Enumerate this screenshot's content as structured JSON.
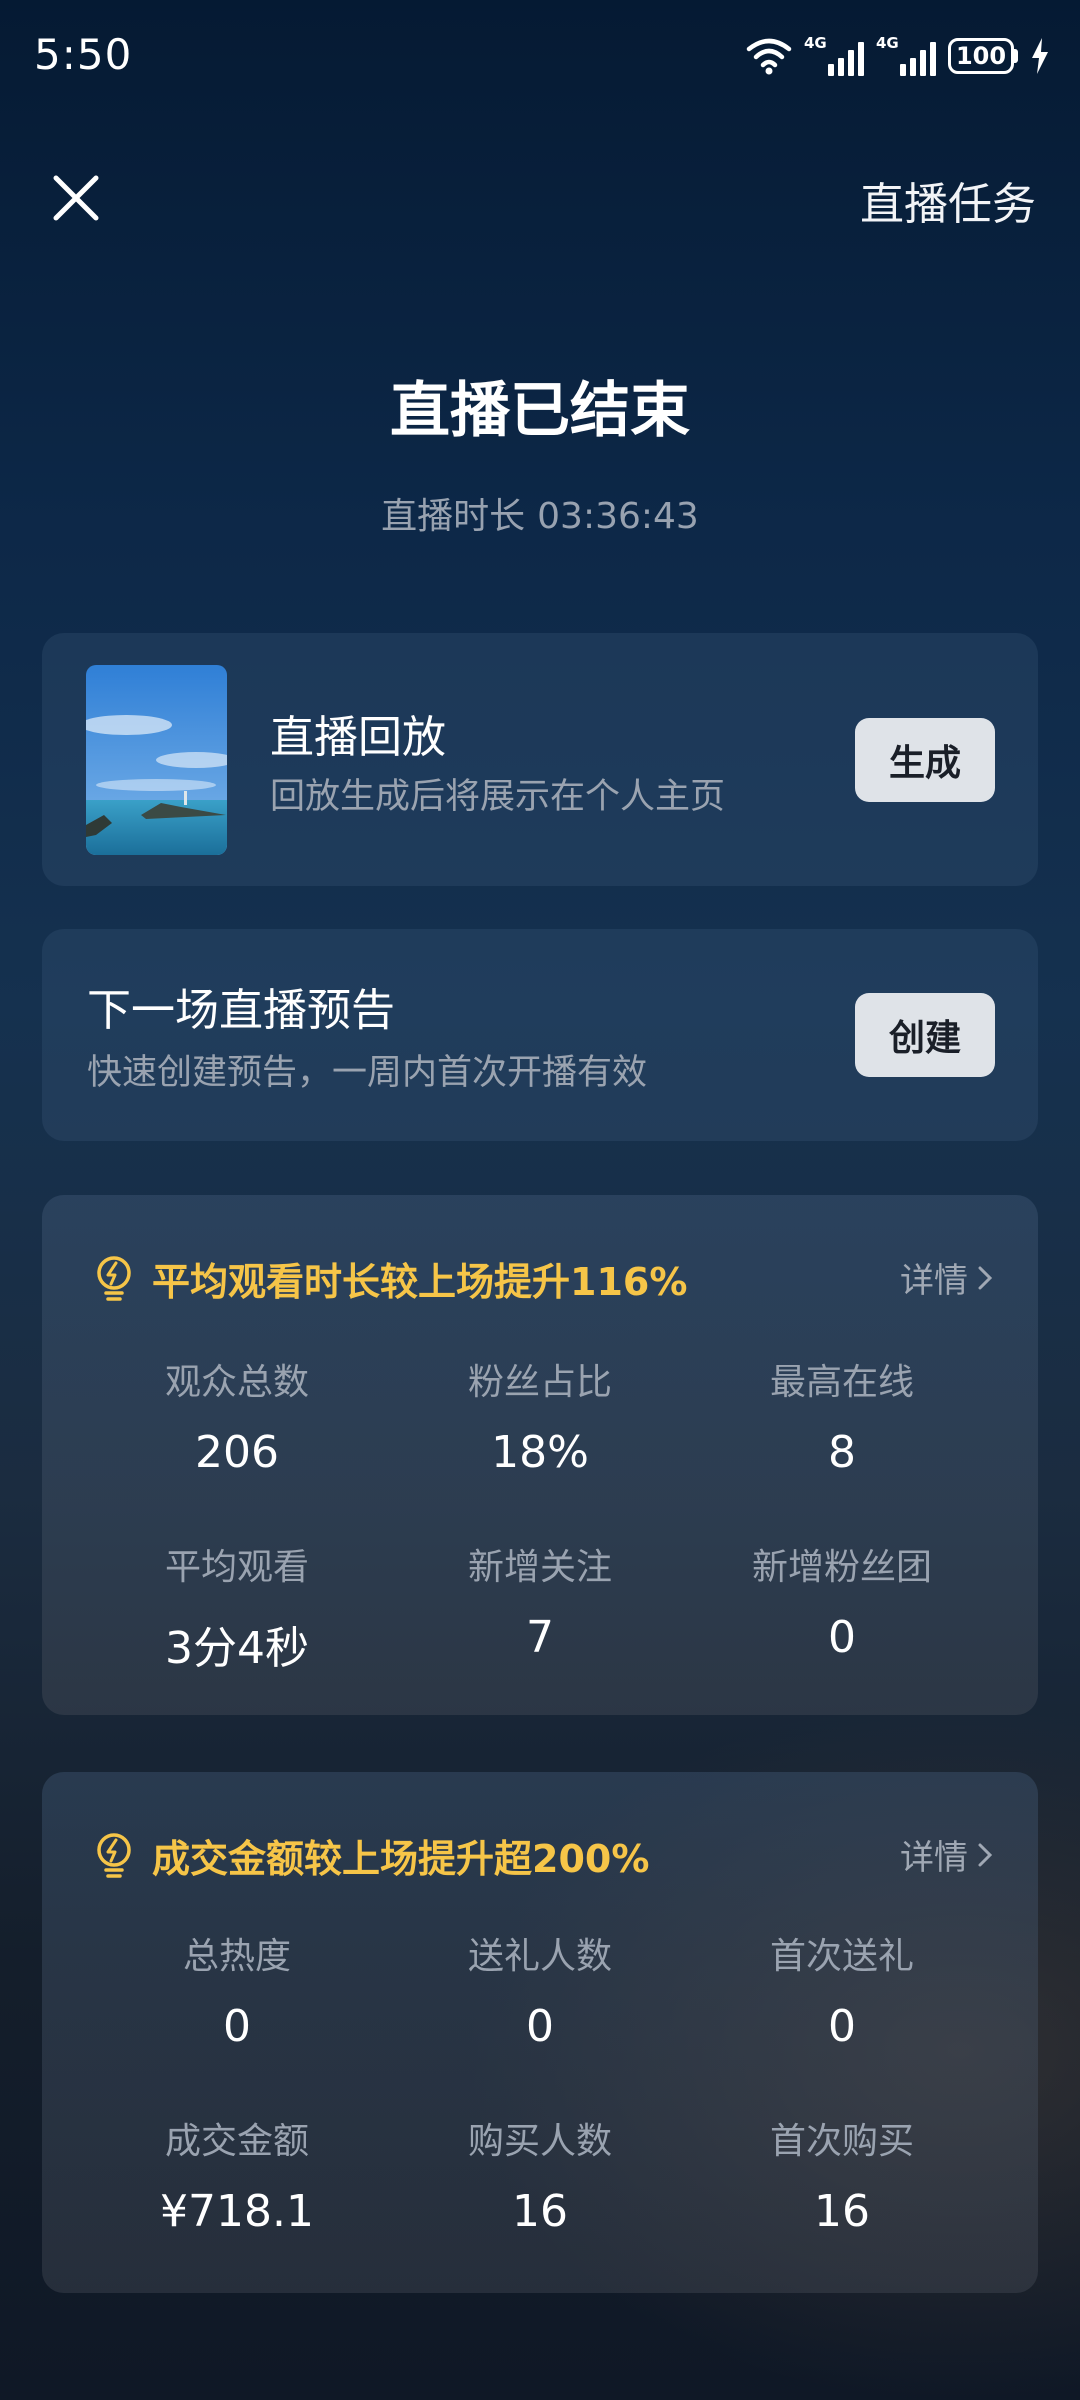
{
  "status_bar": {
    "time": "5:50",
    "net1": "4G",
    "net2": "4G",
    "battery": "100",
    "icons": [
      "wifi-icon",
      "signal-icon",
      "signal-icon",
      "battery-icon",
      "charging-icon"
    ]
  },
  "header": {
    "close_icon": "close-icon",
    "task_link": "直播任务"
  },
  "title": "直播已结束",
  "duration": {
    "label": "直播时长",
    "value": "03:36:43"
  },
  "replay": {
    "title": "直播回放",
    "subtitle": "回放生成后将展示在个人主页",
    "button": "生成"
  },
  "preview": {
    "title": "下一场直播预告",
    "subtitle": "快速创建预告，一周内首次开播有效",
    "button": "创建"
  },
  "audience_stats": {
    "headline": "平均观看时长较上场提升116%",
    "detail": "详情",
    "items": [
      {
        "label": "观众总数",
        "value": "206"
      },
      {
        "label": "粉丝占比",
        "value": "18%"
      },
      {
        "label": "最高在线",
        "value": "8"
      },
      {
        "label": "平均观看",
        "value": "3分4秒"
      },
      {
        "label": "新增关注",
        "value": "7"
      },
      {
        "label": "新增粉丝团",
        "value": "0"
      }
    ]
  },
  "sales_stats": {
    "headline": "成交金额较上场提升超200%",
    "detail": "详情",
    "items": [
      {
        "label": "总热度",
        "value": "0"
      },
      {
        "label": "送礼人数",
        "value": "0"
      },
      {
        "label": "首次送礼",
        "value": "0"
      },
      {
        "label": "成交金额",
        "value": "¥718.1"
      },
      {
        "label": "购买人数",
        "value": "16"
      },
      {
        "label": "首次购买",
        "value": "16"
      }
    ]
  },
  "colors": {
    "accent_yellow": "#f6c548",
    "button_bg": "#dfe3e8"
  }
}
